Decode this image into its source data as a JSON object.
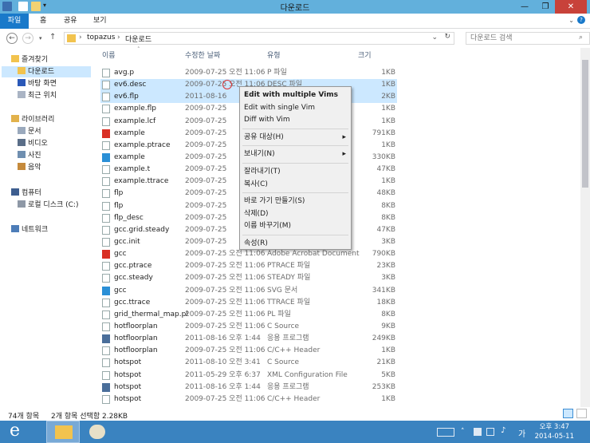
{
  "window": {
    "title": "다운로드"
  },
  "ribbon": {
    "tabs": [
      "파일",
      "홈",
      "공유",
      "보기"
    ]
  },
  "address": {
    "path": [
      "topazus",
      "다운로드"
    ],
    "search_placeholder": "다운로드 검색"
  },
  "nav": {
    "favorites": "즐겨찾기",
    "fav_items": [
      "다운로드",
      "바탕 화면",
      "최근 위치"
    ],
    "libraries": "라이브러리",
    "lib_items": [
      "문서",
      "비디오",
      "사진",
      "음악"
    ],
    "computer": "컴퓨터",
    "comp_items": [
      "로컬 디스크 (C:)"
    ],
    "network": "네트워크"
  },
  "columns": {
    "name": "이름",
    "date": "수정한 날짜",
    "type": "유형",
    "size": "크기"
  },
  "files": [
    {
      "name": "avg.p",
      "date": "2009-07-25 오전 11:06",
      "type": "P 파일",
      "size": "1KB"
    },
    {
      "name": "ev6.desc",
      "date": "2009-07-25 오전 11:06",
      "type": "DESC 파일",
      "size": "1KB",
      "selected": true
    },
    {
      "name": "ev6.flp",
      "date": "2011-08-16",
      "type": "",
      "size": "2KB",
      "selected": true
    },
    {
      "name": "example.flp",
      "date": "2009-07-25",
      "type": "",
      "size": "1KB"
    },
    {
      "name": "example.lcf",
      "date": "2009-07-25",
      "type": "",
      "size": "1KB"
    },
    {
      "name": "example",
      "date": "2009-07-25",
      "type": "",
      "size": "791KB",
      "icon": "pdf"
    },
    {
      "name": "example.ptrace",
      "date": "2009-07-25",
      "type": "",
      "size": "1KB"
    },
    {
      "name": "example",
      "date": "2009-07-25",
      "type": "",
      "size": "330KB",
      "icon": "ie"
    },
    {
      "name": "example.t",
      "date": "2009-07-25",
      "type": "",
      "size": "47KB"
    },
    {
      "name": "example.ttrace",
      "date": "2009-07-25",
      "type": "",
      "size": "1KB"
    },
    {
      "name": "flp",
      "date": "2009-07-25",
      "type": "",
      "size": "48KB"
    },
    {
      "name": "flp",
      "date": "2009-07-25",
      "type": "",
      "size": "8KB"
    },
    {
      "name": "flp_desc",
      "date": "2009-07-25",
      "type": "",
      "size": "8KB"
    },
    {
      "name": "gcc.grid.steady",
      "date": "2009-07-25",
      "type": "",
      "size": "47KB"
    },
    {
      "name": "gcc.init",
      "date": "2009-07-25",
      "type": "",
      "size": "3KB"
    },
    {
      "name": "gcc",
      "date": "2009-07-25 오전 11:06",
      "type": "Adobe Acrobat Document",
      "size": "790KB",
      "icon": "pdf"
    },
    {
      "name": "gcc.ptrace",
      "date": "2009-07-25 오전 11:06",
      "type": "PTRACE 파일",
      "size": "23KB"
    },
    {
      "name": "gcc.steady",
      "date": "2009-07-25 오전 11:06",
      "type": "STEADY 파일",
      "size": "3KB"
    },
    {
      "name": "gcc",
      "date": "2009-07-25 오전 11:06",
      "type": "SVG 문서",
      "size": "341KB",
      "icon": "ie"
    },
    {
      "name": "gcc.ttrace",
      "date": "2009-07-25 오전 11:06",
      "type": "TTRACE 파일",
      "size": "18KB"
    },
    {
      "name": "grid_thermal_map.pl",
      "date": "2009-07-25 오전 11:06",
      "type": "PL 파일",
      "size": "8KB"
    },
    {
      "name": "hotfloorplan",
      "date": "2009-07-25 오전 11:06",
      "type": "C Source",
      "size": "9KB"
    },
    {
      "name": "hotfloorplan",
      "date": "2011-08-16 오후 1:44",
      "type": "응용 프로그램",
      "size": "249KB",
      "icon": "exe"
    },
    {
      "name": "hotfloorplan",
      "date": "2009-07-25 오전 11:06",
      "type": "C/C++ Header",
      "size": "1KB"
    },
    {
      "name": "hotspot",
      "date": "2011-08-10 오전 3:41",
      "type": "C Source",
      "size": "21KB"
    },
    {
      "name": "hotspot",
      "date": "2011-05-29 오후 6:37",
      "type": "XML Configuration File",
      "size": "5KB"
    },
    {
      "name": "hotspot",
      "date": "2011-08-16 오후 1:44",
      "type": "응용 프로그램",
      "size": "253KB",
      "icon": "exe"
    },
    {
      "name": "hotspot",
      "date": "2009-07-25 오전 11:06",
      "type": "C/C++ Header",
      "size": "1KB"
    }
  ],
  "context_menu": [
    {
      "label": "Edit with multiple Vims",
      "bold": true
    },
    {
      "label": "Edit with single Vim"
    },
    {
      "label": "Diff with Vim"
    },
    {
      "sep": true
    },
    {
      "label": "공유 대상(H)",
      "submenu": true
    },
    {
      "sep": true
    },
    {
      "label": "보내기(N)",
      "submenu": true
    },
    {
      "sep": true
    },
    {
      "label": "잘라내기(T)"
    },
    {
      "label": "복사(C)"
    },
    {
      "sep": true
    },
    {
      "label": "바로 가기 만들기(S)"
    },
    {
      "label": "삭제(D)"
    },
    {
      "label": "이름 바꾸기(M)"
    },
    {
      "sep": true
    },
    {
      "label": "속성(R)"
    }
  ],
  "status": {
    "count": "74개 항목",
    "selection": "2개 항목 선택함 2.28KB"
  },
  "clock": {
    "time": "오후 3:47",
    "date": "2014-05-11"
  },
  "tray": {
    "ime": "가"
  }
}
